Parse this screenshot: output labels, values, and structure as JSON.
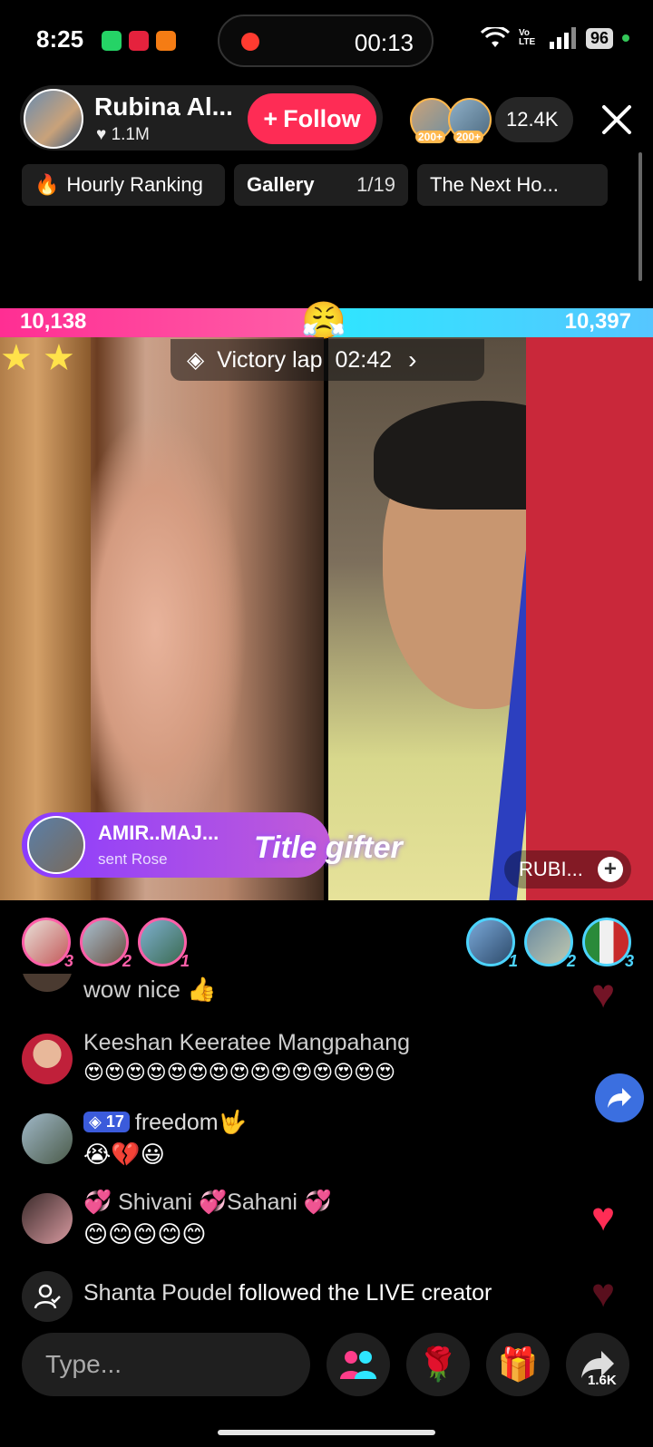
{
  "status_bar": {
    "time": "8:25",
    "recording_time": "00:13",
    "battery": "96",
    "carrier": "Vo LTE"
  },
  "host": {
    "name": "Rubina Al...",
    "likes": "1.1M",
    "follow_label": "Follow"
  },
  "viewers": {
    "badge_1": "200+",
    "badge_2": "200+",
    "count": "12.4K"
  },
  "chips": {
    "ranking": "Hourly Ranking",
    "gallery": "Gallery",
    "gallery_page": "1/19",
    "next": "The Next Ho..."
  },
  "battle": {
    "left_score": "10,138",
    "right_score": "10,397",
    "left_share": 0.494,
    "victory_label": "Victory lap",
    "victory_time": "02:42",
    "gift_user": "AMIR..MAJ...",
    "gift_action": "sent Rose",
    "title_gifter": "Title gifter",
    "opponent_name": "RUBI..."
  },
  "supporters": {
    "left": [
      {
        "rank": "3"
      },
      {
        "rank": "2"
      },
      {
        "rank": "1"
      }
    ],
    "right": [
      {
        "rank": "1"
      },
      {
        "rank": "2"
      },
      {
        "rank": "3"
      }
    ]
  },
  "comments": [
    {
      "name": "",
      "message": "wow nice 👍"
    },
    {
      "name": "Keeshan Keeratee Mangpahang",
      "message": "😍😍😍😍😍😍😍😍😍😍😍😍😍😍😍"
    },
    {
      "level": "17",
      "name": "freedom🤟",
      "message": "😭💔😃"
    },
    {
      "name": "💞 Shivani 💞Sahani 💞",
      "message": "😊😊😊😊😊"
    }
  ],
  "follow_event": {
    "user": "Shanta Poudel",
    "text": "followed the LIVE creator"
  },
  "bottom": {
    "placeholder": "Type...",
    "share_count": "1.6K"
  },
  "colors": {
    "follow": "#fe2c55",
    "left_team": "#ff2e93",
    "right_team": "#2ee6ff",
    "gift_banner": "#8a3cff"
  }
}
